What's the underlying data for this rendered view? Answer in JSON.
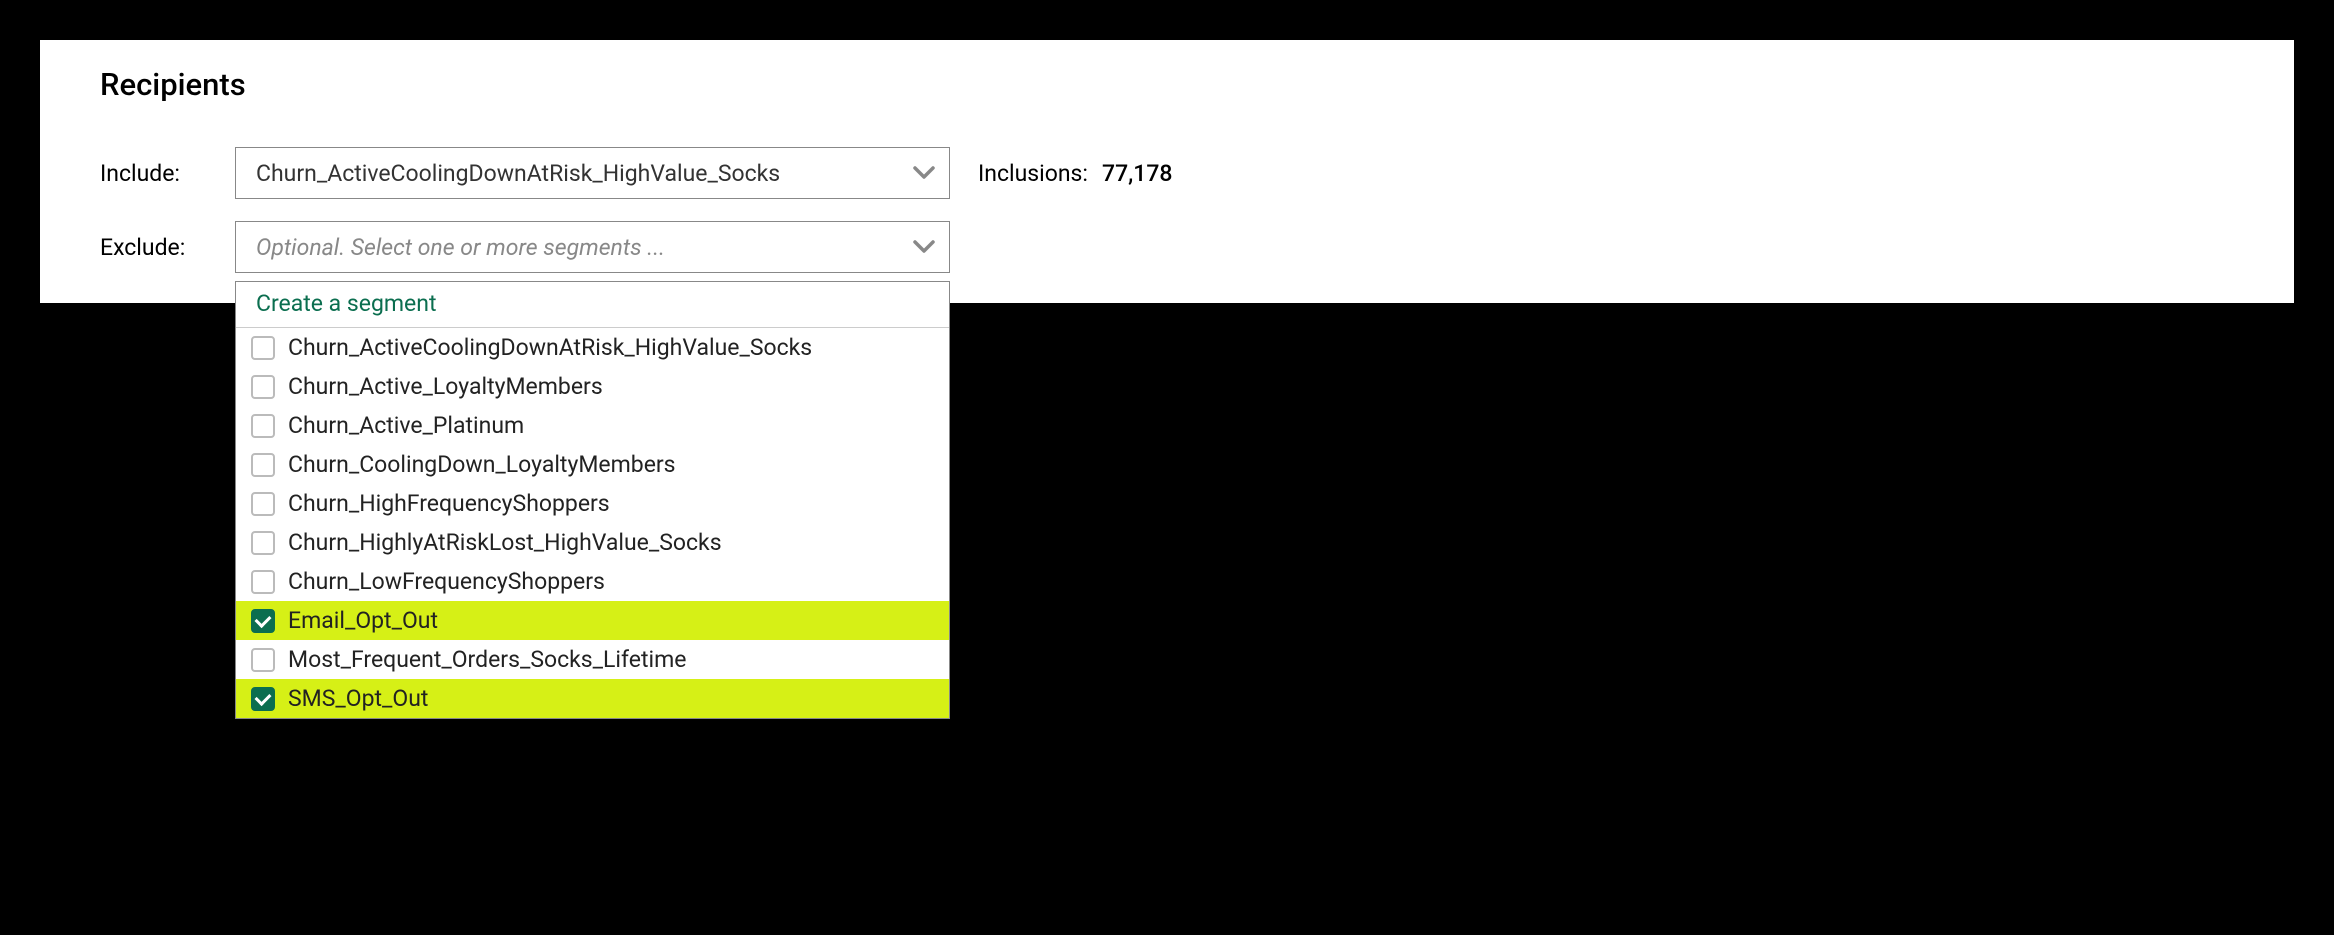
{
  "section_title": "Recipients",
  "include": {
    "label": "Include:",
    "selected": "Churn_ActiveCoolingDownAtRisk_HighValue_Socks"
  },
  "exclude": {
    "label": "Exclude:",
    "placeholder": "Optional. Select one or more segments ..."
  },
  "inclusions": {
    "label": "Inclusions:",
    "count": "77,178"
  },
  "dropdown": {
    "create_link": "Create a segment",
    "options": [
      {
        "label": "Churn_ActiveCoolingDownAtRisk_HighValue_Socks",
        "selected": false
      },
      {
        "label": "Churn_Active_LoyaltyMembers",
        "selected": false
      },
      {
        "label": "Churn_Active_Platinum",
        "selected": false
      },
      {
        "label": "Churn_CoolingDown_LoyaltyMembers",
        "selected": false
      },
      {
        "label": "Churn_HighFrequencyShoppers",
        "selected": false
      },
      {
        "label": "Churn_HighlyAtRiskLost_HighValue_Socks",
        "selected": false
      },
      {
        "label": "Churn_LowFrequencyShoppers",
        "selected": false
      },
      {
        "label": "Email_Opt_Out",
        "selected": true
      },
      {
        "label": "Most_Frequent_Orders_Socks_Lifetime",
        "selected": false
      },
      {
        "label": "SMS_Opt_Out",
        "selected": true
      }
    ]
  }
}
